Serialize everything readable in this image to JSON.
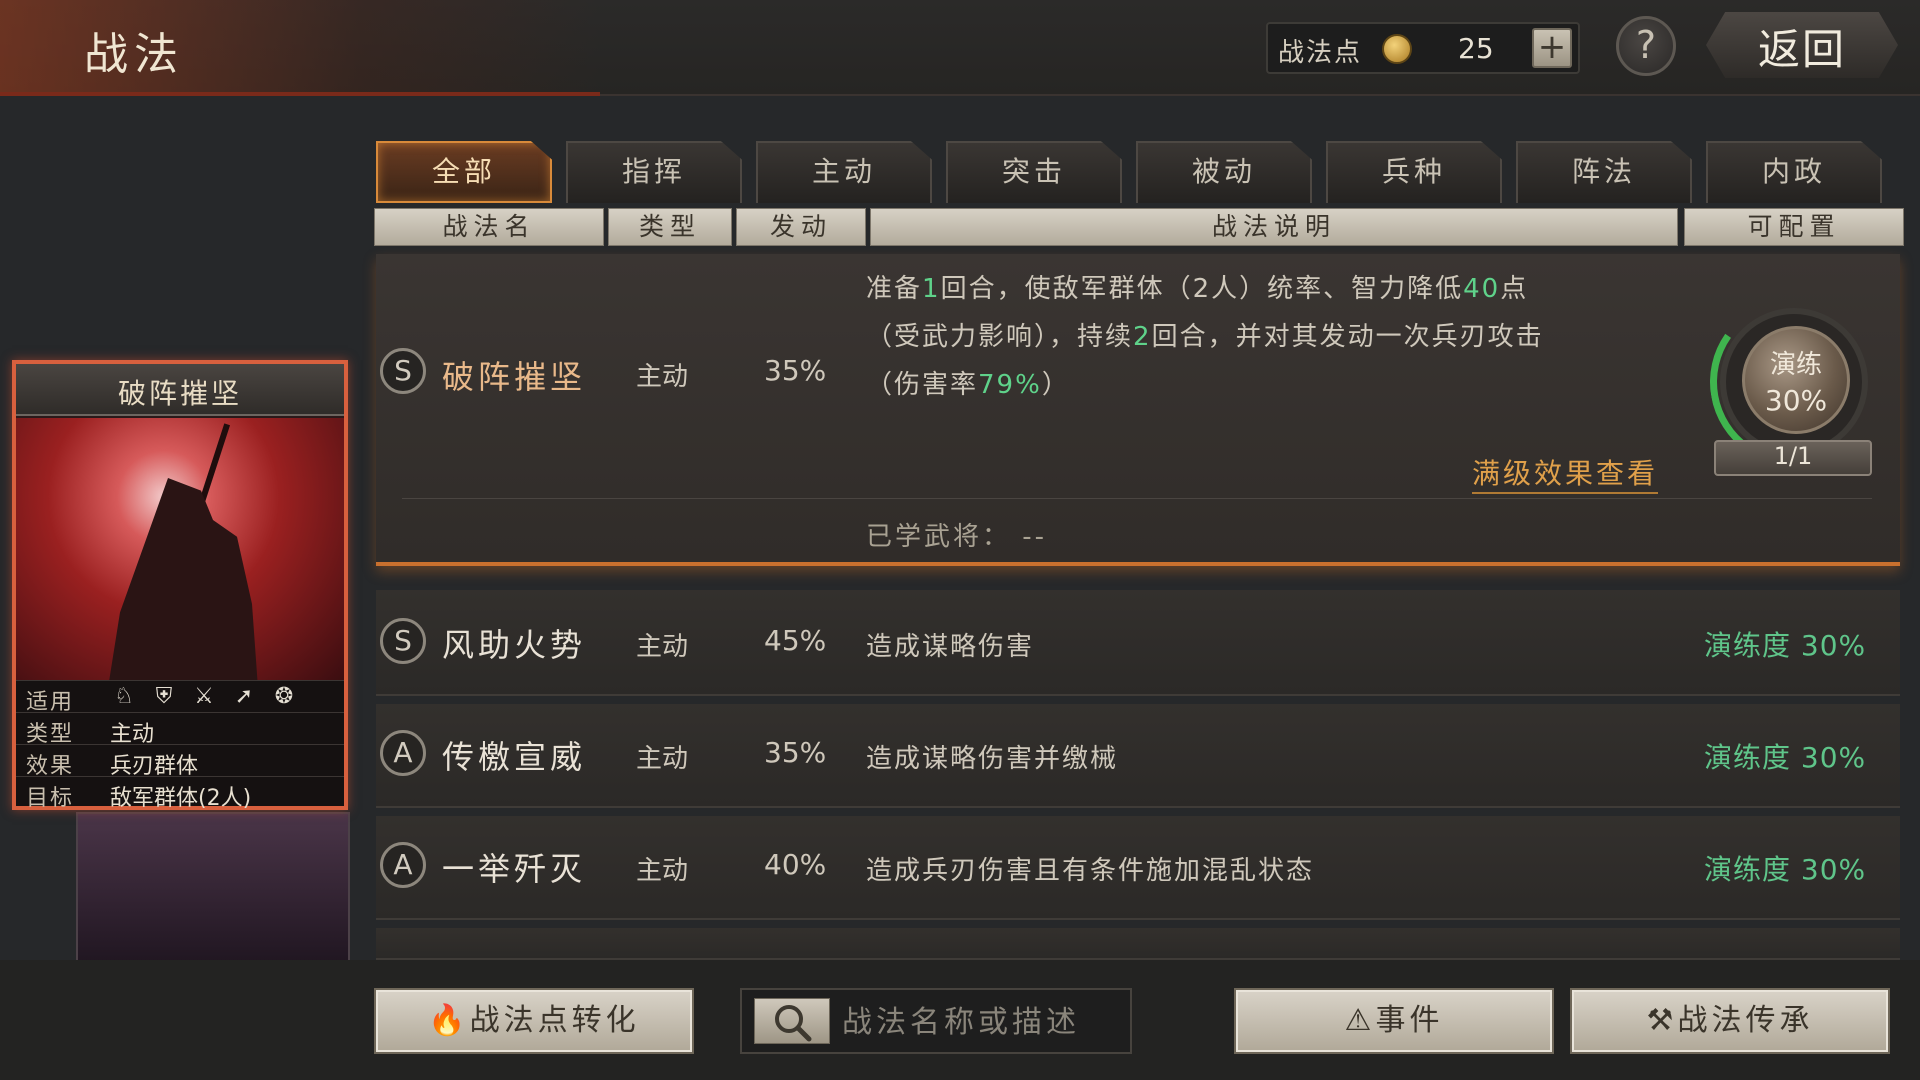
{
  "header": {
    "title": "战法",
    "points_label": "战法点",
    "points_value": "25",
    "add_label": "+",
    "help_label": "?",
    "back_label": "返回"
  },
  "tabs": [
    {
      "label": "全部",
      "active": true
    },
    {
      "label": "指挥"
    },
    {
      "label": "主动"
    },
    {
      "label": "突击"
    },
    {
      "label": "被动"
    },
    {
      "label": "兵种"
    },
    {
      "label": "阵法"
    },
    {
      "label": "内政"
    }
  ],
  "columns": [
    "战法名",
    "类型",
    "发动",
    "战法说明",
    "可配置"
  ],
  "card": {
    "title": "破阵摧坚",
    "applicable_label": "适用",
    "type_label": "类型",
    "type_value": "主动",
    "effect_label": "效果",
    "effect_value": "兵刃群体",
    "target_label": "目标",
    "target_value": "敌军群体(2人)"
  },
  "expanded": {
    "grade": "S",
    "name": "破阵摧坚",
    "type": "主动",
    "rate": "35%",
    "desc_line1_a": "准备",
    "desc_line1_b": "1",
    "desc_line1_c": "回合，使敌军群体（2人）统率、智力降低",
    "desc_line1_d": "40",
    "desc_line1_e": "点",
    "desc_line2_a": "（受武力影响），持续",
    "desc_line2_b": "2",
    "desc_line2_c": "回合，并对其发动一次兵刃攻击",
    "desc_line3_a": "（伤害率",
    "desc_line3_b": "79%",
    "desc_line3_c": "）",
    "train_label": "演练",
    "train_pct": "30%",
    "train_progress": 0.3,
    "config_count": "1/1",
    "full_effect_link": "满级效果查看",
    "learned_label": "已学武将：",
    "learned_value": "--"
  },
  "rows": [
    {
      "grade": "S",
      "name": "风助火势",
      "type": "主动",
      "rate": "45%",
      "desc": "造成谋略伤害",
      "progress": "演练度 30%"
    },
    {
      "grade": "A",
      "name": "传檄宣威",
      "type": "主动",
      "rate": "35%",
      "desc": "造成谋略伤害并缴械",
      "progress": "演练度 30%"
    },
    {
      "grade": "A",
      "name": "一举歼灭",
      "type": "主动",
      "rate": "40%",
      "desc": "造成兵刃伤害且有条件施加混乱状态",
      "progress": "演练度 30%"
    }
  ],
  "bottom": {
    "convert_label": "战法点转化",
    "search_placeholder": "战法名称或描述",
    "event_label": "事件",
    "inherit_label": "战法传承"
  },
  "colors": {
    "accent": "#d88a3a",
    "progress_green": "#5fc58a",
    "link_orange": "#e0a04a"
  }
}
